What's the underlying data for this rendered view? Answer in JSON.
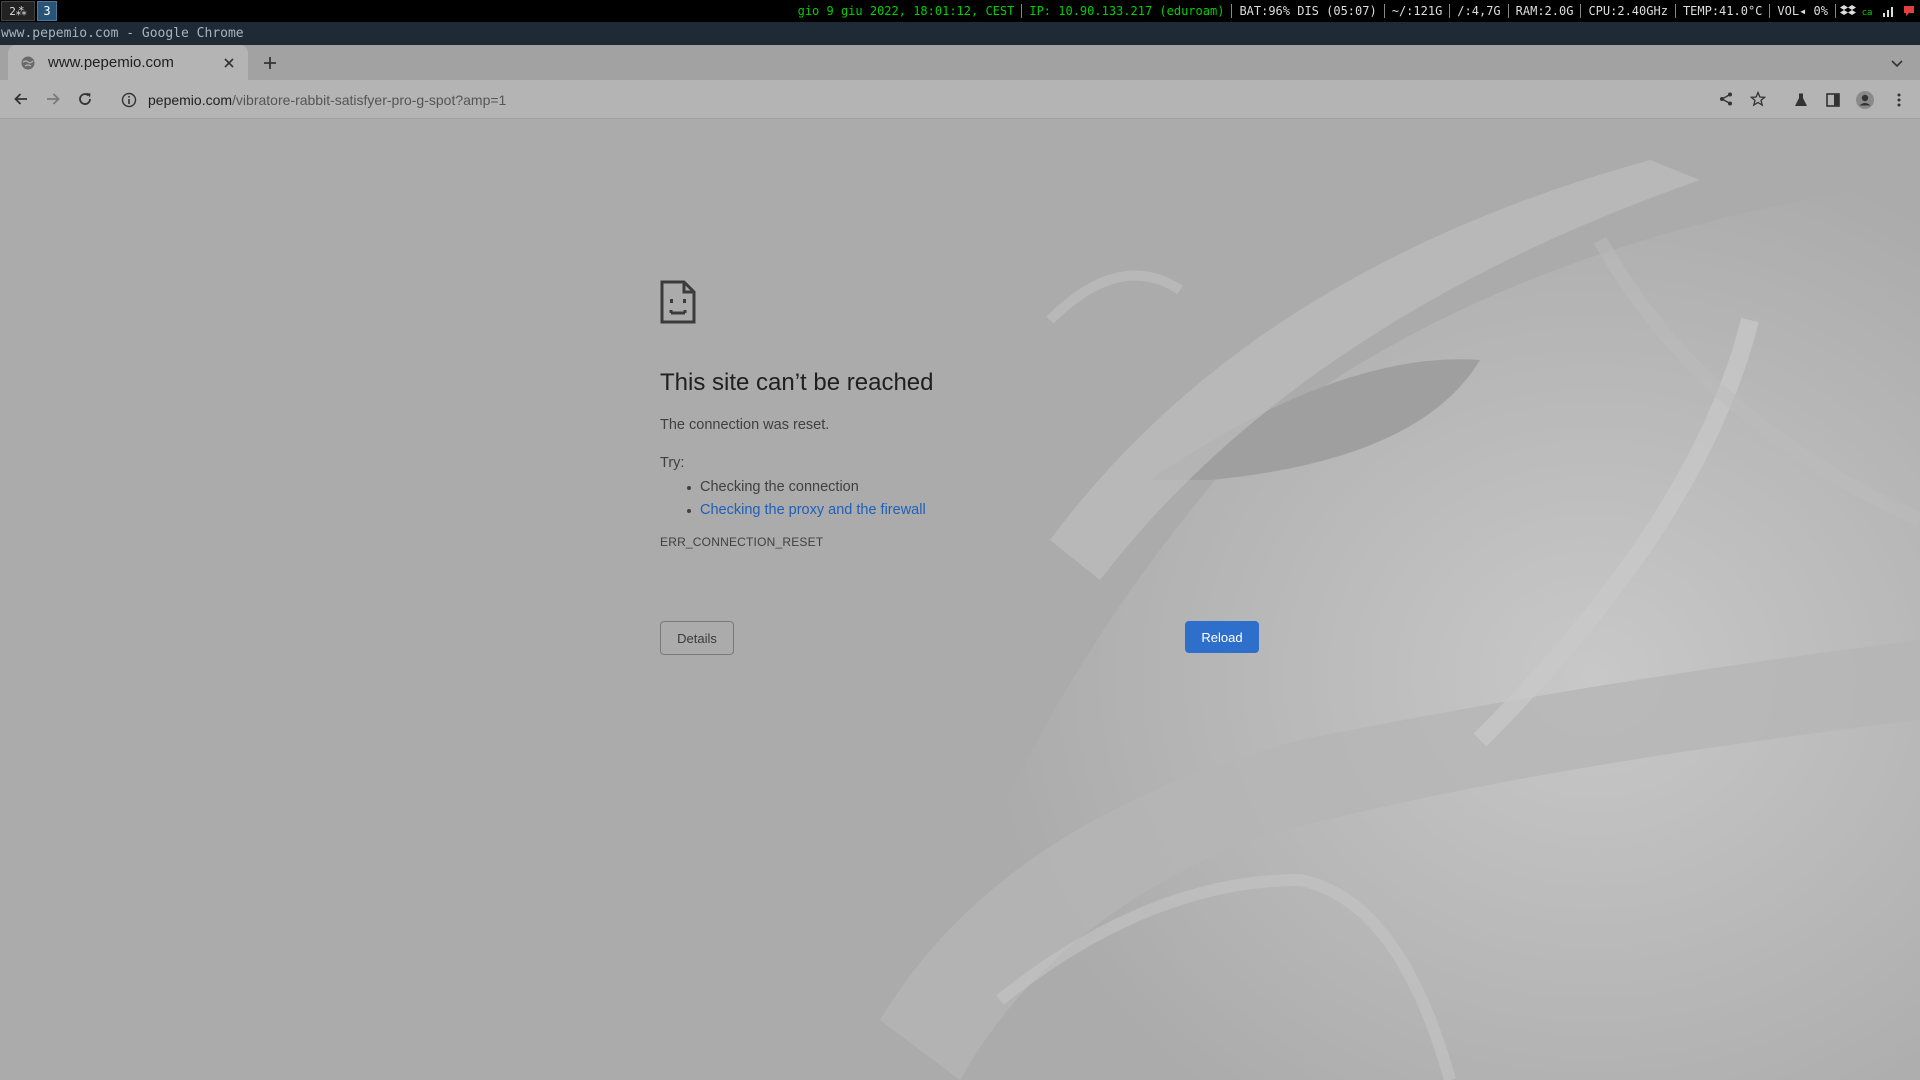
{
  "topbar": {
    "workspaces": [
      "2⁂",
      "3"
    ],
    "status": [
      {
        "text": "gio 9 giu 2022, 18:01:12, CEST",
        "color": "green"
      },
      {
        "text": "IP: 10.90.133.217 (eduroam)",
        "color": "green"
      },
      {
        "text": "BAT:96% DIS (05:07)",
        "color": "white"
      },
      {
        "text": "~/:121G",
        "color": "white"
      },
      {
        "text": "/:4,7G",
        "color": "white"
      },
      {
        "text": "RAM:2.0G",
        "color": "white"
      },
      {
        "text": "CPU:2.40GHz",
        "color": "white"
      },
      {
        "text": "TEMP:41.0°C",
        "color": "white"
      },
      {
        "text": "VOL◂  0%",
        "color": "white"
      }
    ]
  },
  "window": {
    "title": "www.pepemio.com - Google Chrome"
  },
  "tab": {
    "title": "www.pepemio.com"
  },
  "omnibox": {
    "url_host": "pepemio.com",
    "url_path": "/vibratore-rabbit-satisfyer-pro-g-spot?amp=1"
  },
  "error": {
    "heading": "This site can’t be reached",
    "description": "The connection was reset.",
    "try_label": "Try:",
    "suggestions": [
      "Checking the connection",
      "Checking the proxy and the firewall"
    ],
    "code": "ERR_CONNECTION_RESET",
    "details_label": "Details",
    "reload_label": "Reload"
  },
  "colors": {
    "accent": "#2f6fcc",
    "link": "#1f5fb8",
    "status_green": "#00d000"
  }
}
